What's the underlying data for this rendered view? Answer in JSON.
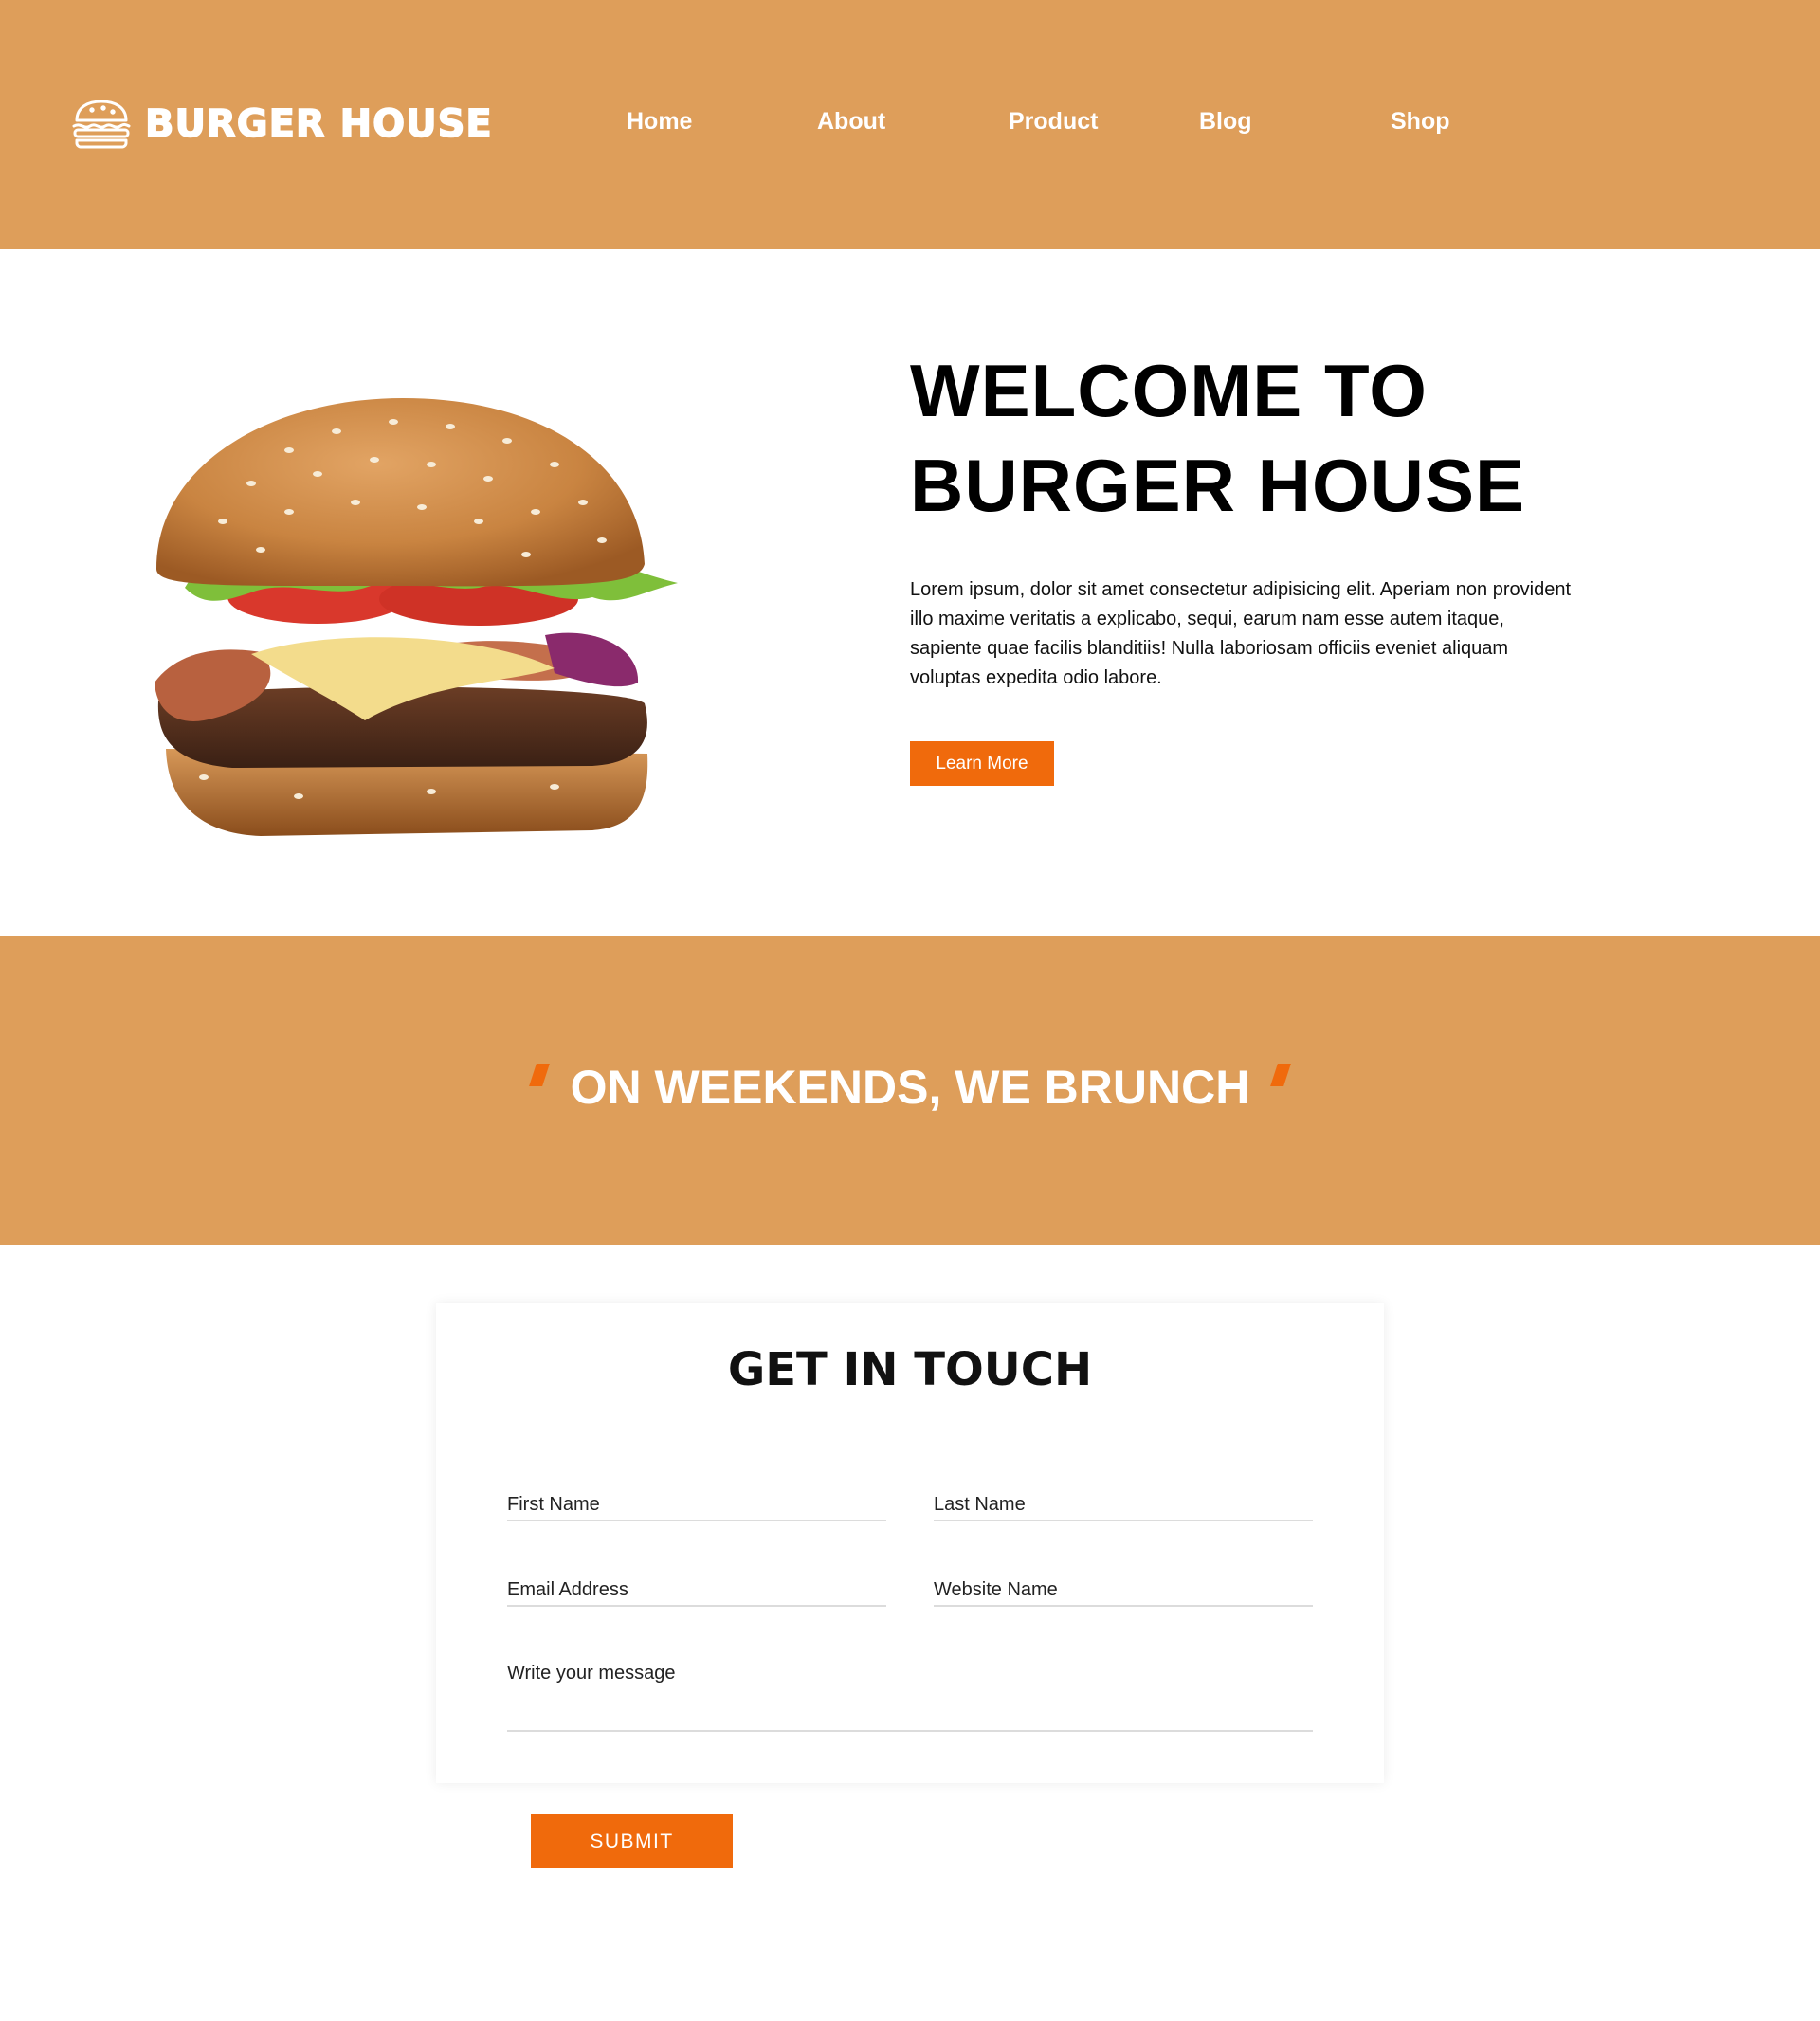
{
  "colors": {
    "header_bg": "#de9e5a",
    "accent": "#f06a0c",
    "text": "#111111"
  },
  "header": {
    "brand": "BURGER HOUSE",
    "logo_icon": "burger-icon",
    "nav": [
      "Home",
      "About",
      "Product",
      "Blog",
      "Shop"
    ]
  },
  "hero": {
    "image": "burger-photo",
    "title_line1": "WELCOME TO",
    "title_line2": "BURGER HOUSE",
    "description": "Lorem ipsum, dolor sit amet consectetur adipisicing elit. Aperiam non provident illo maxime veritatis a explicabo, sequi, earum nam esse autem itaque, sapiente quae facilis blanditiis! Nulla laboriosam officiis eveniet aliquam voluptas expedita odio labore.",
    "button": "Learn More"
  },
  "band": {
    "quote": "ON WEEKENDS, WE BRUNCH"
  },
  "contact": {
    "title": "GET IN TOUCH",
    "first_name_placeholder": "First Name",
    "last_name_placeholder": "Last Name",
    "email_placeholder": "Email Address",
    "website_placeholder": "Website Name",
    "message_placeholder": "Write your message",
    "submit": "SUBMIT"
  }
}
